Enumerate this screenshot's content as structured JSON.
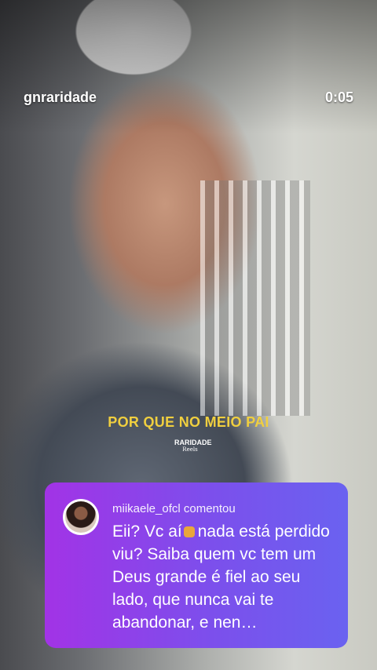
{
  "header": {
    "account": "gnraridade",
    "timestamp": "0:05"
  },
  "video": {
    "caption": "POR QUE NO MEIO PAI",
    "watermark_top": "RARIDADE",
    "watermark_bottom": "Reels"
  },
  "comment": {
    "author_line": "miikaele_ofcl comentou",
    "text_before_emoji": "Eii? Vc aí",
    "emoji": "fist-icon",
    "text_after_emoji": "nada está perdido viu? Saiba quem vc tem um Deus grande é fiel ao seu lado, que nunca vai te abandonar, e nen…",
    "colors": {
      "start": "#a233e6",
      "end": "#6a62f0"
    }
  }
}
